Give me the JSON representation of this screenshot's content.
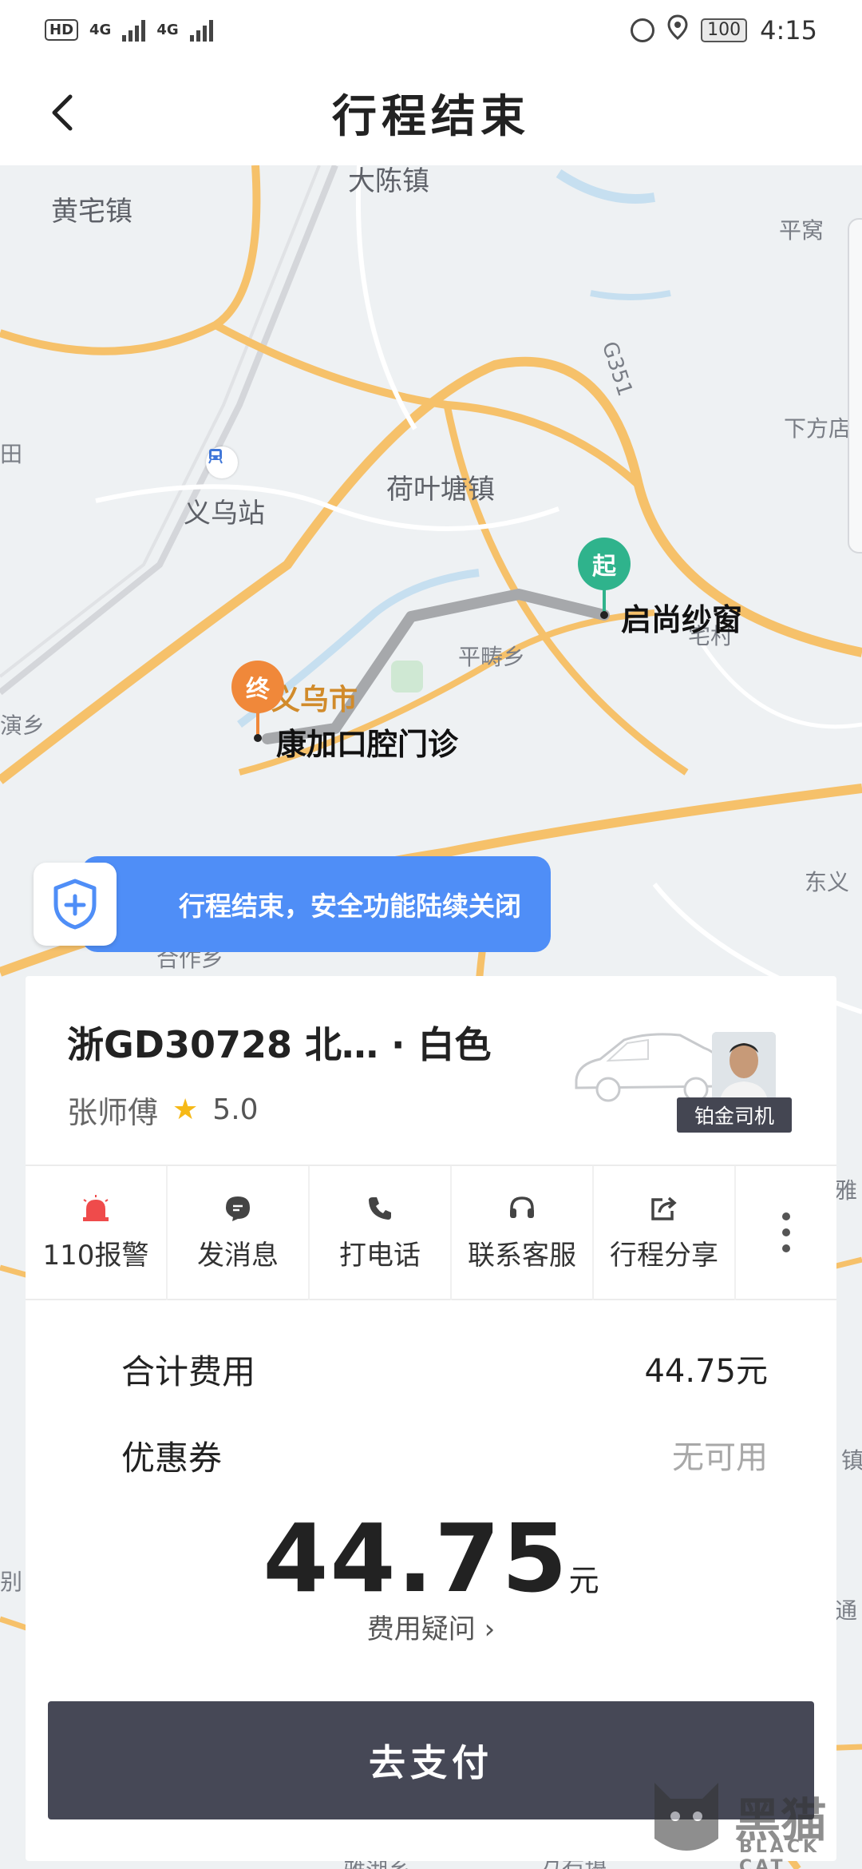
{
  "status": {
    "hd": "HD",
    "net1": "4G",
    "net2": "4G",
    "battery": "100",
    "time": "4:15"
  },
  "header": {
    "title": "行程结束"
  },
  "map": {
    "places": {
      "huangzhai": "黄宅镇",
      "dachen": "大陈镇",
      "pingwo": "平窝",
      "xiafangdian": "下方店",
      "tian": "田",
      "yiwu_station": "义乌站",
      "heyetang": "荷叶塘镇",
      "pingchou": "平畴乡",
      "yan": "演乡",
      "yiwu_city": "义乌市",
      "dongyi": "东义",
      "zhaizhai": "宅村",
      "fuxiang": "合作乡",
      "ya": "雅",
      "zhen": "镇",
      "bie": "别",
      "yanhu": "雅湖乡",
      "fangyan": "方岩镇",
      "tong": "通",
      "highway": "G351"
    },
    "start_pin": "起",
    "end_pin": "终",
    "start_name": "启尚纱窗",
    "end_name": "康加口腔门诊"
  },
  "safety_banner": {
    "text": "行程结束，安全功能陆续关闭"
  },
  "driver": {
    "plate": "浙GD30728  北…    · 白色",
    "name": "张师傅",
    "rating": "5.0",
    "badge": "铂金司机"
  },
  "actions": [
    {
      "label": "110报警",
      "icon": "alarm-icon"
    },
    {
      "label": "发消息",
      "icon": "message-icon"
    },
    {
      "label": "打电话",
      "icon": "phone-icon"
    },
    {
      "label": "联系客服",
      "icon": "headset-icon"
    },
    {
      "label": "行程分享",
      "icon": "share-icon"
    }
  ],
  "fees": {
    "total_label": "合计费用",
    "total_value": "44.75元",
    "coupon_label": "优惠券",
    "coupon_value": "无可用",
    "amount": "44.75",
    "unit": "元",
    "question": "费用疑问 ›"
  },
  "pay_button": "去支付",
  "watermark": {
    "text": "黑猫",
    "sub": "BLACK CAT"
  },
  "colors": {
    "accent_blue": "#4f8ef7",
    "start_green": "#2fb38c",
    "end_orange": "#f0883a",
    "pay_button": "#464856"
  }
}
